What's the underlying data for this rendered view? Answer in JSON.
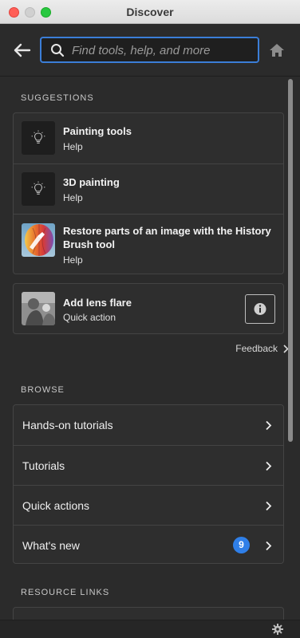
{
  "window": {
    "title": "Discover"
  },
  "search": {
    "placeholder": "Find tools, help, and more"
  },
  "suggestions": {
    "heading": "SUGGESTIONS",
    "items": [
      {
        "title": "Painting tools",
        "subtitle": "Help",
        "icon": "lightbulb-icon"
      },
      {
        "title": "3D painting",
        "subtitle": "Help",
        "icon": "lightbulb-icon"
      },
      {
        "title_line1": "Restore parts of an image with the History",
        "title_line2": "Brush tool",
        "subtitle": "Help",
        "icon": "history-brush-thumbnail"
      }
    ],
    "action": {
      "title": "Add lens flare",
      "subtitle": "Quick action",
      "icon": "info-icon"
    },
    "feedback": "Feedback"
  },
  "browse": {
    "heading": "BROWSE",
    "items": [
      {
        "label": "Hands-on tutorials"
      },
      {
        "label": "Tutorials"
      },
      {
        "label": "Quick actions"
      },
      {
        "label": "What's new",
        "badge": "9"
      }
    ]
  },
  "resources": {
    "heading": "RESOURCE LINKS"
  },
  "colors": {
    "accent": "#3b7ed8",
    "badge": "#2f7fe8",
    "panel": "#2b2b2b"
  }
}
